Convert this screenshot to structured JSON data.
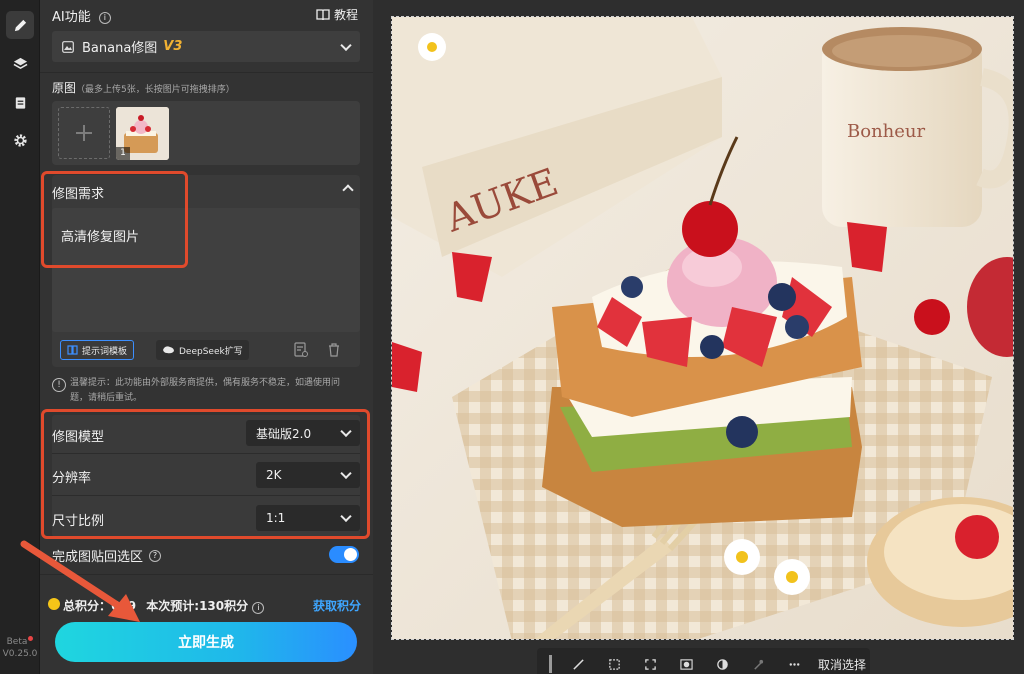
{
  "sidebar_version": {
    "beta": "Beta",
    "version": "V0.25.0"
  },
  "panel": {
    "ai_title": "AI功能",
    "tutorial": "教程",
    "feature_select": {
      "name": "Banana修图",
      "version": "V3"
    },
    "source": {
      "title": "原图",
      "hint": "（最多上传5张，长按图片可拖拽排序）",
      "thumb_index": "1"
    },
    "request": {
      "title": "修图需求",
      "text": "高清修复图片",
      "template_btn": "提示词模板",
      "deepseek_btn": "DeepSeek扩写"
    },
    "tip": "温馨提示：此功能由外部服务商提供，偶有服务不稳定，如遇使用问题，请稍后重试。",
    "settings": [
      {
        "label": "修图模型",
        "value": "基础版2.0"
      },
      {
        "label": "分辨率",
        "value": "2K"
      },
      {
        "label": "尺寸比例",
        "value": "1:1"
      }
    ],
    "paste_back": {
      "label": "完成图贴回选区",
      "enabled": true
    },
    "points": {
      "total_prefix": "总积分：",
      "total_value": "669",
      "estimate": "本次预计:130积分",
      "get_points": "获取积分"
    },
    "generate_btn": "立即生成"
  },
  "canvas": {
    "image_alt_texts": {
      "book_text": "AUKE",
      "mug_text": "Bonheur"
    },
    "toolbar": {
      "deselect": "取消选择"
    }
  },
  "colors": {
    "accent_cyan": "#1fc7e6",
    "annotation_red": "#e04a2c",
    "toggle": "#2a8cff"
  }
}
